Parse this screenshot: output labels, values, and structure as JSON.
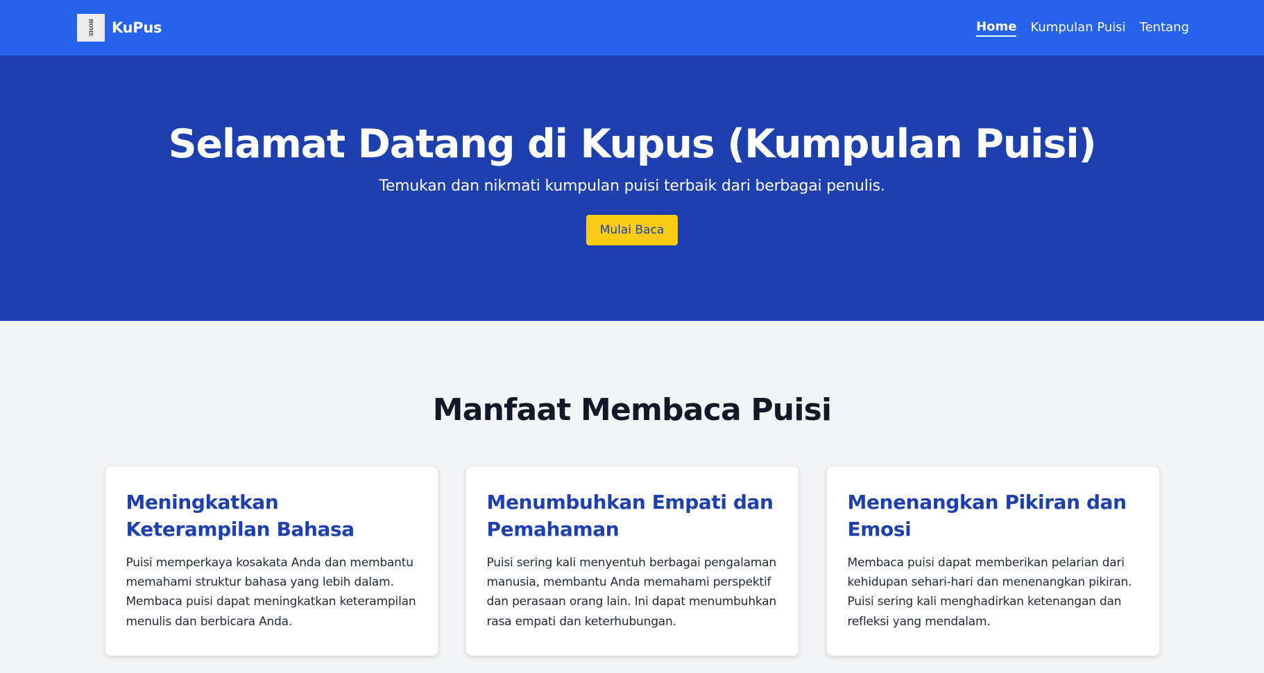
{
  "navbar": {
    "logo_text": "HOME",
    "brand_name": "KuPus",
    "links": [
      {
        "label": "Home",
        "active": true
      },
      {
        "label": "Kumpulan Puisi",
        "active": false
      },
      {
        "label": "Tentang",
        "active": false
      }
    ]
  },
  "hero": {
    "title": "Selamat Datang di Kupus (Kumpulan Puisi)",
    "subtitle": "Temukan dan nikmati kumpulan puisi terbaik dari berbagai penulis.",
    "button_label": "Mulai Baca"
  },
  "benefits": {
    "title": "Manfaat Membaca Puisi",
    "cards": [
      {
        "title": "Meningkatkan Keterampilan Bahasa",
        "text": "Puisi memperkaya kosakata Anda dan membantu memahami struktur bahasa yang lebih dalam. Membaca puisi dapat meningkatkan keterampilan menulis dan berbicara Anda."
      },
      {
        "title": "Menumbuhkan Empati dan Pemahaman",
        "text": "Puisi sering kali menyentuh berbagai pengalaman manusia, membantu Anda memahami perspektif dan perasaan orang lain. Ini dapat menumbuhkan rasa empati dan keterhubungan."
      },
      {
        "title": "Menenangkan Pikiran dan Emosi",
        "text": "Membaca puisi dapat memberikan pelarian dari kehidupan sehari-hari dan menenangkan pikiran. Puisi sering kali menghadirkan ketenangan dan refleksi yang mendalam."
      }
    ]
  },
  "colors": {
    "navbar_bg": "#2563eb",
    "hero_bg": "#1e40af",
    "accent_button": "#facc15",
    "page_bg": "#f3f4f6"
  }
}
